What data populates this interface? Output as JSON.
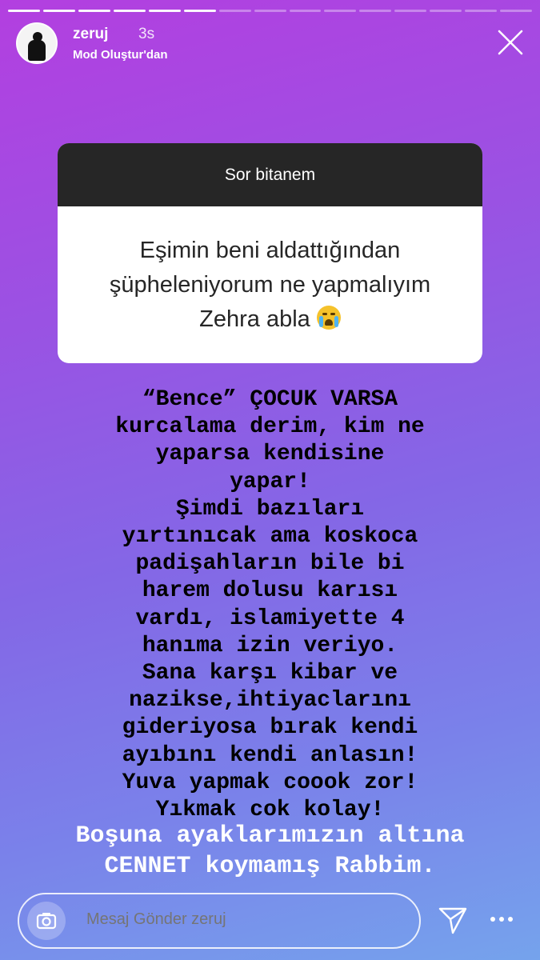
{
  "header": {
    "username": "zeruj",
    "time": "3s",
    "subtitle": "Mod Oluştur'dan"
  },
  "progress": {
    "total_segments": 15,
    "completed_segments": 6
  },
  "question_card": {
    "title": "Sor bitanem",
    "lines": [
      "Eşimin beni aldattığından",
      "şüpheleniyorum ne yapmalıyım",
      "Zehra abla"
    ],
    "emoji_icon": "loudly-crying-face-icon"
  },
  "story_text": [
    "“Bence” ÇOCUK VARSA",
    "kurcalama derim, kim ne",
    "yaparsa kendisine",
    "yapar!",
    "Şimdi bazıları",
    "yırtınıcak ama koskoca",
    "padişahların bile bi",
    "harem dolusu karısı",
    "vardı, islamiyette 4",
    "hanıma izin veriyo.",
    "Sana karşı kibar ve",
    "nazikse,ihtiyaclarını",
    "gideriyosa bırak kendi",
    "ayıbını kendi anlasın!",
    "Yuva yapmak coook zor!",
    "Yıkmak cok kolay!"
  ],
  "footer_text": [
    "Boşuna ayaklarımızın altına",
    "CENNET koymamış Rabbim."
  ],
  "message_bar": {
    "placeholder": "Mesaj Gönder zeruj",
    "camera_icon": "camera-icon",
    "send_icon": "send-icon",
    "more_icon": "more-icon"
  },
  "colors": {
    "gradient_top": "#b33fe0",
    "gradient_bottom": "#75a3ec",
    "card_header": "#262626"
  }
}
